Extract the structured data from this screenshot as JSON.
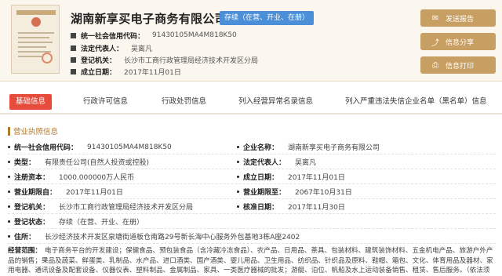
{
  "company": {
    "name": "湖南新享买电子商务有限公司",
    "status_tag": "存续（在营、开业、在册）"
  },
  "header_rows": [
    {
      "label": "统一社会信用代码：",
      "value": "91430105MA4M818K50"
    },
    {
      "label": "法定代表人：",
      "value": "吴离凡"
    },
    {
      "label": "登记机关：",
      "value": "长沙市工商行政管理局经济技术开发区分局"
    },
    {
      "label": "成立日期：",
      "value": "2017年11月01日"
    }
  ],
  "actions": [
    {
      "label": "发送报告",
      "icon": "send-icon",
      "glyph": "✉"
    },
    {
      "label": "信息分享",
      "icon": "share-icon",
      "glyph": "⤴"
    },
    {
      "label": "信息打印",
      "icon": "print-icon",
      "glyph": "⎙"
    }
  ],
  "tabs": [
    "基础信息",
    "行政许可信息",
    "行政处罚信息",
    "列入经营异常名录信息",
    "列入严重违法失信企业名单（黑名单）信息"
  ],
  "section_title": "营业执照信息",
  "info": {
    "credit_code_label": "统一社会信用代码：",
    "credit_code": "91430105MA4M818K50",
    "name_label": "企业名称：",
    "name": "湖南新享买电子商务有限公司",
    "type_label": "类型：",
    "type": "有限责任公司(自然人投资或控股)",
    "rep_label": "法定代表人：",
    "rep": "吴离凡",
    "capital_label": "注册资本：",
    "capital": "1000.000000万人民币",
    "founded_label": "成立日期：",
    "founded": "2017年11月01日",
    "term_from_label": "营业期限自：",
    "term_from": "2017年11月01日",
    "term_to_label": "营业期限至：",
    "term_to": "2067年10月31日",
    "authority_label": "登记机关：",
    "authority": "长沙市工商行政管理局经济技术开发区分局",
    "approval_label": "核准日期：",
    "approval": "2017年11月30日",
    "reg_status_label": "登记状态：",
    "reg_status": "存续（在营、开业、在册）",
    "address_label": "住所：",
    "address": "长沙经济技术开发区泉塘街道板仓南路29号新长海中心服务外包基地3栋A座2402",
    "scope_label": "经营范围：",
    "scope": "电子商务平台的开发建设；保健食品、预包装食品（含冷藏冷冻食品）、农产品、日用品、茶具、包装材料、建筑装饰材料、五金机电产品、旅游户外产品的销售；果品及蔬菜、鲜蛋类、乳制品、水产品、进口酒类、国产酒类、婴儿用品、卫生用品、纺织品、针织品及原料、鞋帽、箱包、文化、体育用品及器材、家用电器、通讯设备及配套设备、仪器仪表、塑料制品、金属制品、家具、一类医疗器械的批发；游艇、泊位、帆船及水上运动装备销售、租赁、售后服务。（依法须经批准的项目，经相关部门批准后方可开展经营活动）"
  },
  "colors": {
    "accent_red": "#e64b3b",
    "gold": "#c79f62",
    "status_blue": "#4a8fd8",
    "section_brown": "#b17b2c"
  }
}
